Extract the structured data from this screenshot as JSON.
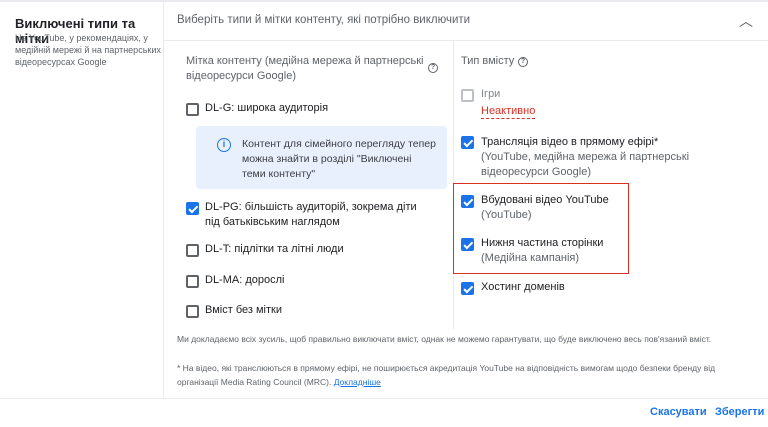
{
  "section": {
    "title": "Виключені типи та мітки",
    "description": "На YouTube, у рекомендаціях, у медійній мережі й на партнерських відеоресурсах Google"
  },
  "main": {
    "instruction": "Виберіть типи й мітки контенту, які потрібно виключити",
    "labels_column": {
      "title": "Мітка контенту (медійна мережа й партнерські відеоресурси Google)",
      "items": [
        {
          "label": "DL-G: широка аудиторія",
          "checked": false
        },
        {
          "label": "DL-PG: більшість аудиторій, зокрема діти під батьківським наглядом",
          "checked": true
        },
        {
          "label": "DL-T: підлітки та літні люди",
          "checked": false
        },
        {
          "label": "DL-MA: дорослі",
          "checked": false
        },
        {
          "label": "Вміст без мітки",
          "checked": false
        }
      ],
      "info": "Контент для сімейного перегляду тепер можна знайти в розділі \"Виключені теми контенту\""
    },
    "types_column": {
      "title": "Тип вмісту",
      "items": [
        {
          "label": "Ігри",
          "sub": "",
          "status": "Неактивно",
          "checked": false,
          "disabled": true
        },
        {
          "label": "Трансляція відео в прямому ефірі*",
          "sub": "(YouTube, медійна мережа й партнерські відеоресурси Google)",
          "checked": true
        },
        {
          "label": "Вбудовані відео YouTube",
          "sub": "(YouTube)",
          "checked": true
        },
        {
          "label": "Нижня частина сторінки",
          "sub": "(Медійна кампанія)",
          "checked": true
        },
        {
          "label": "Хостинг доменів",
          "sub": "",
          "checked": true
        }
      ]
    },
    "note1": "Ми докладаємо всіх зусиль, щоб правильно виключати вміст, однак не можемо гарантувати, що буде виключено весь пов'язаний вміст.",
    "note2": "* На відео, які транслюються в прямому ефірі, не поширюється акредитація YouTube на відповідність вимогам щодо безпеки бренду від організації Media Rating Council (MRC).",
    "note2_link": "Докладніше"
  },
  "actions": {
    "cancel": "Скасувати",
    "save": "Зберегти"
  },
  "colors": {
    "accent": "#1a73e8",
    "error": "#d93025"
  }
}
